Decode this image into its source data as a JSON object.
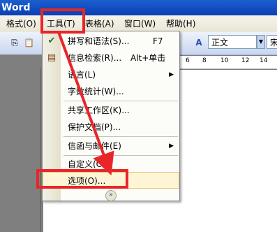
{
  "window": {
    "title": "Word"
  },
  "menubar": [
    {
      "label": "格式(O)"
    },
    {
      "label": "工具(T)"
    },
    {
      "label": "表格(A)"
    },
    {
      "label": "窗口(W)"
    },
    {
      "label": "帮助(H)"
    }
  ],
  "toolbar": {
    "style_value": "正文",
    "font_value": "宋"
  },
  "ruler": {
    "ticks": [
      "6",
      "8",
      "10",
      "12",
      "14"
    ]
  },
  "tools_menu": {
    "items": [
      {
        "label": "拼写和语法(S)...",
        "shortcut": "F7"
      },
      {
        "label": "信息检索(R)...",
        "shortcut": "Alt+单击"
      },
      {
        "label": "语言(L)"
      },
      {
        "label": "字数统计(W)..."
      },
      {
        "label": "共享工作区(K)..."
      },
      {
        "label": "保护文档(P)..."
      },
      {
        "label": "信函与邮件(E)"
      },
      {
        "label": "自定义(C)..."
      },
      {
        "label": "选项(O)..."
      }
    ]
  },
  "annotation_color": "#e8262a"
}
